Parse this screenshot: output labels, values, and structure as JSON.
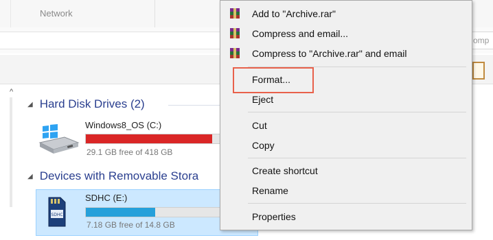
{
  "ribbon": {
    "network_tab": "Network"
  },
  "search": {
    "partial_text": "omp"
  },
  "groups": {
    "hard_disk": {
      "label": "Hard Disk Drives (2)"
    },
    "removable": {
      "label": "Devices with Removable Stora"
    }
  },
  "drives": [
    {
      "name": "Windows8_OS (C:)",
      "free_text": "29.1 GB free of 418 GB",
      "used_fraction": 0.93,
      "bar_color": "#da2626"
    },
    {
      "name": "SDHC (E:)",
      "free_text": "7.18 GB free of 14.8 GB",
      "used_fraction": 0.51,
      "bar_color": "#26a0da"
    }
  ],
  "context_menu": {
    "items": [
      "Add to \"Archive.rar\"",
      "Compress and email...",
      "Compress to \"Archive.rar\" and email",
      "Format...",
      "Eject",
      "Cut",
      "Copy",
      "Create shortcut",
      "Rename",
      "Properties"
    ],
    "highlighted_item": "Format..."
  },
  "colors": {
    "accent_blue": "#2a3f8f",
    "selection": "#cce8ff",
    "highlight_outline": "#e8604a"
  }
}
